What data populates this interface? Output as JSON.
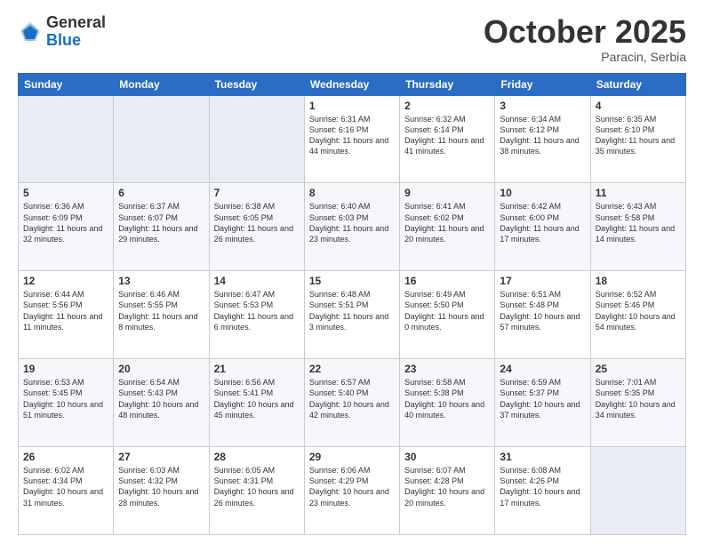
{
  "logo": {
    "general": "General",
    "blue": "Blue"
  },
  "header": {
    "month": "October 2025",
    "location": "Paracin, Serbia"
  },
  "weekdays": [
    "Sunday",
    "Monday",
    "Tuesday",
    "Wednesday",
    "Thursday",
    "Friday",
    "Saturday"
  ],
  "weeks": [
    [
      {
        "day": "",
        "sunrise": "",
        "sunset": "",
        "daylight": ""
      },
      {
        "day": "",
        "sunrise": "",
        "sunset": "",
        "daylight": ""
      },
      {
        "day": "",
        "sunrise": "",
        "sunset": "",
        "daylight": ""
      },
      {
        "day": "1",
        "sunrise": "Sunrise: 6:31 AM",
        "sunset": "Sunset: 6:16 PM",
        "daylight": "Daylight: 11 hours and 44 minutes."
      },
      {
        "day": "2",
        "sunrise": "Sunrise: 6:32 AM",
        "sunset": "Sunset: 6:14 PM",
        "daylight": "Daylight: 11 hours and 41 minutes."
      },
      {
        "day": "3",
        "sunrise": "Sunrise: 6:34 AM",
        "sunset": "Sunset: 6:12 PM",
        "daylight": "Daylight: 11 hours and 38 minutes."
      },
      {
        "day": "4",
        "sunrise": "Sunrise: 6:35 AM",
        "sunset": "Sunset: 6:10 PM",
        "daylight": "Daylight: 11 hours and 35 minutes."
      }
    ],
    [
      {
        "day": "5",
        "sunrise": "Sunrise: 6:36 AM",
        "sunset": "Sunset: 6:09 PM",
        "daylight": "Daylight: 11 hours and 32 minutes."
      },
      {
        "day": "6",
        "sunrise": "Sunrise: 6:37 AM",
        "sunset": "Sunset: 6:07 PM",
        "daylight": "Daylight: 11 hours and 29 minutes."
      },
      {
        "day": "7",
        "sunrise": "Sunrise: 6:38 AM",
        "sunset": "Sunset: 6:05 PM",
        "daylight": "Daylight: 11 hours and 26 minutes."
      },
      {
        "day": "8",
        "sunrise": "Sunrise: 6:40 AM",
        "sunset": "Sunset: 6:03 PM",
        "daylight": "Daylight: 11 hours and 23 minutes."
      },
      {
        "day": "9",
        "sunrise": "Sunrise: 6:41 AM",
        "sunset": "Sunset: 6:02 PM",
        "daylight": "Daylight: 11 hours and 20 minutes."
      },
      {
        "day": "10",
        "sunrise": "Sunrise: 6:42 AM",
        "sunset": "Sunset: 6:00 PM",
        "daylight": "Daylight: 11 hours and 17 minutes."
      },
      {
        "day": "11",
        "sunrise": "Sunrise: 6:43 AM",
        "sunset": "Sunset: 5:58 PM",
        "daylight": "Daylight: 11 hours and 14 minutes."
      }
    ],
    [
      {
        "day": "12",
        "sunrise": "Sunrise: 6:44 AM",
        "sunset": "Sunset: 5:56 PM",
        "daylight": "Daylight: 11 hours and 11 minutes."
      },
      {
        "day": "13",
        "sunrise": "Sunrise: 6:46 AM",
        "sunset": "Sunset: 5:55 PM",
        "daylight": "Daylight: 11 hours and 8 minutes."
      },
      {
        "day": "14",
        "sunrise": "Sunrise: 6:47 AM",
        "sunset": "Sunset: 5:53 PM",
        "daylight": "Daylight: 11 hours and 6 minutes."
      },
      {
        "day": "15",
        "sunrise": "Sunrise: 6:48 AM",
        "sunset": "Sunset: 5:51 PM",
        "daylight": "Daylight: 11 hours and 3 minutes."
      },
      {
        "day": "16",
        "sunrise": "Sunrise: 6:49 AM",
        "sunset": "Sunset: 5:50 PM",
        "daylight": "Daylight: 11 hours and 0 minutes."
      },
      {
        "day": "17",
        "sunrise": "Sunrise: 6:51 AM",
        "sunset": "Sunset: 5:48 PM",
        "daylight": "Daylight: 10 hours and 57 minutes."
      },
      {
        "day": "18",
        "sunrise": "Sunrise: 6:52 AM",
        "sunset": "Sunset: 5:46 PM",
        "daylight": "Daylight: 10 hours and 54 minutes."
      }
    ],
    [
      {
        "day": "19",
        "sunrise": "Sunrise: 6:53 AM",
        "sunset": "Sunset: 5:45 PM",
        "daylight": "Daylight: 10 hours and 51 minutes."
      },
      {
        "day": "20",
        "sunrise": "Sunrise: 6:54 AM",
        "sunset": "Sunset: 5:43 PM",
        "daylight": "Daylight: 10 hours and 48 minutes."
      },
      {
        "day": "21",
        "sunrise": "Sunrise: 6:56 AM",
        "sunset": "Sunset: 5:41 PM",
        "daylight": "Daylight: 10 hours and 45 minutes."
      },
      {
        "day": "22",
        "sunrise": "Sunrise: 6:57 AM",
        "sunset": "Sunset: 5:40 PM",
        "daylight": "Daylight: 10 hours and 42 minutes."
      },
      {
        "day": "23",
        "sunrise": "Sunrise: 6:58 AM",
        "sunset": "Sunset: 5:38 PM",
        "daylight": "Daylight: 10 hours and 40 minutes."
      },
      {
        "day": "24",
        "sunrise": "Sunrise: 6:59 AM",
        "sunset": "Sunset: 5:37 PM",
        "daylight": "Daylight: 10 hours and 37 minutes."
      },
      {
        "day": "25",
        "sunrise": "Sunrise: 7:01 AM",
        "sunset": "Sunset: 5:35 PM",
        "daylight": "Daylight: 10 hours and 34 minutes."
      }
    ],
    [
      {
        "day": "26",
        "sunrise": "Sunrise: 6:02 AM",
        "sunset": "Sunset: 4:34 PM",
        "daylight": "Daylight: 10 hours and 31 minutes."
      },
      {
        "day": "27",
        "sunrise": "Sunrise: 6:03 AM",
        "sunset": "Sunset: 4:32 PM",
        "daylight": "Daylight: 10 hours and 28 minutes."
      },
      {
        "day": "28",
        "sunrise": "Sunrise: 6:05 AM",
        "sunset": "Sunset: 4:31 PM",
        "daylight": "Daylight: 10 hours and 26 minutes."
      },
      {
        "day": "29",
        "sunrise": "Sunrise: 6:06 AM",
        "sunset": "Sunset: 4:29 PM",
        "daylight": "Daylight: 10 hours and 23 minutes."
      },
      {
        "day": "30",
        "sunrise": "Sunrise: 6:07 AM",
        "sunset": "Sunset: 4:28 PM",
        "daylight": "Daylight: 10 hours and 20 minutes."
      },
      {
        "day": "31",
        "sunrise": "Sunrise: 6:08 AM",
        "sunset": "Sunset: 4:26 PM",
        "daylight": "Daylight: 10 hours and 17 minutes."
      },
      {
        "day": "",
        "sunrise": "",
        "sunset": "",
        "daylight": ""
      }
    ]
  ]
}
